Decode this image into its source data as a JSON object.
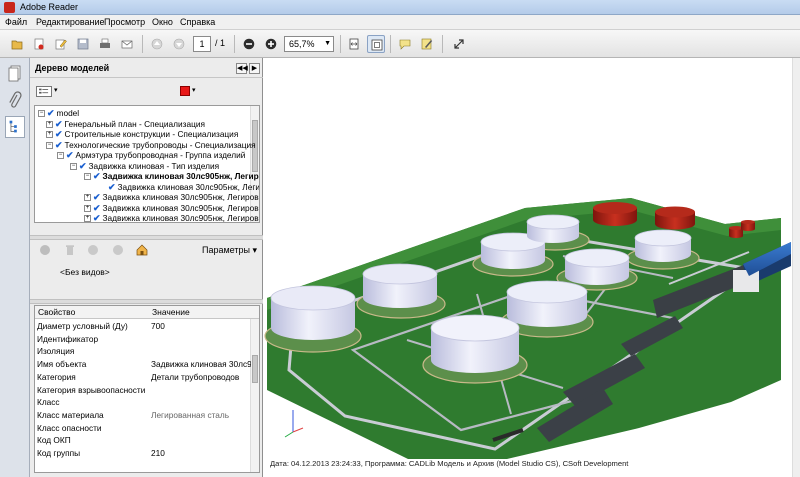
{
  "window": {
    "title": "Adobe Reader"
  },
  "menu": [
    "Файл",
    "Редактирование",
    "Просмотр",
    "Окно",
    "Справка"
  ],
  "toolbar": {
    "page_current": "1",
    "page_total": "/ 1",
    "zoom": "65,7%"
  },
  "panel": {
    "title": "Дерево моделей",
    "color_swatch": "#e81818",
    "tree": [
      {
        "label": "model",
        "depth": 0,
        "expand": "−",
        "bold": false
      },
      {
        "label": "Генеральный план - Специализация",
        "depth": 1,
        "expand": "+",
        "bold": false
      },
      {
        "label": "Строительные конструкции - Специализация",
        "depth": 1,
        "expand": "+",
        "bold": false
      },
      {
        "label": "Технологические трубопроводы - Специализация",
        "depth": 1,
        "expand": "−",
        "bold": false
      },
      {
        "label": "Армэтура трубопроводная - Группа изделий",
        "depth": 2,
        "expand": "−",
        "bold": false
      },
      {
        "label": "Задвижка клиновая - Тип изделия",
        "depth": 3,
        "expand": "−",
        "bold": false
      },
      {
        "label": "Задвижка клиновая 30лс905нж, Легирова",
        "depth": 4,
        "expand": "−",
        "bold": true
      },
      {
        "label": "Задвижка клиновая 30лс905нж, Легирова",
        "depth": 5,
        "expand": "",
        "bold": false
      },
      {
        "label": "Задвижка клиновая 30лс905нж, Легиров",
        "depth": 4,
        "expand": "+",
        "bold": false
      },
      {
        "label": "Задвижка клиновая 30лс905нж, Легиров",
        "depth": 4,
        "expand": "+",
        "bold": false
      },
      {
        "label": "Задвижка клиновая 30лс905нж, Легиров",
        "depth": 4,
        "expand": "+",
        "bold": false
      }
    ],
    "params_label": "Параметры",
    "views_empty": "<Без видов>",
    "props_header": {
      "key": "Свойство",
      "value": "Значение"
    },
    "props": [
      {
        "k": "Диаметр условный (Ду)",
        "v": "700"
      },
      {
        "k": "Идентификатор",
        "v": ""
      },
      {
        "k": "Изоляция",
        "v": ""
      },
      {
        "k": "Имя объекта",
        "v": "Задвижка клиновая 30лс9"
      },
      {
        "k": "Категория",
        "v": "Детали трубопроводов"
      },
      {
        "k": "Категория взрывоопасности",
        "v": ""
      },
      {
        "k": "Класс",
        "v": ""
      },
      {
        "k": "Класс материала",
        "v": "Легированная сталь"
      },
      {
        "k": "Класс опасности",
        "v": ""
      },
      {
        "k": "Код ОКП",
        "v": ""
      },
      {
        "k": "Код группы",
        "v": "210"
      }
    ]
  },
  "status_bar": "Дата: 04.12.2013 23:24:33, Программа: CADLib Модель и Архив (Model Studio CS), CSoft Development"
}
